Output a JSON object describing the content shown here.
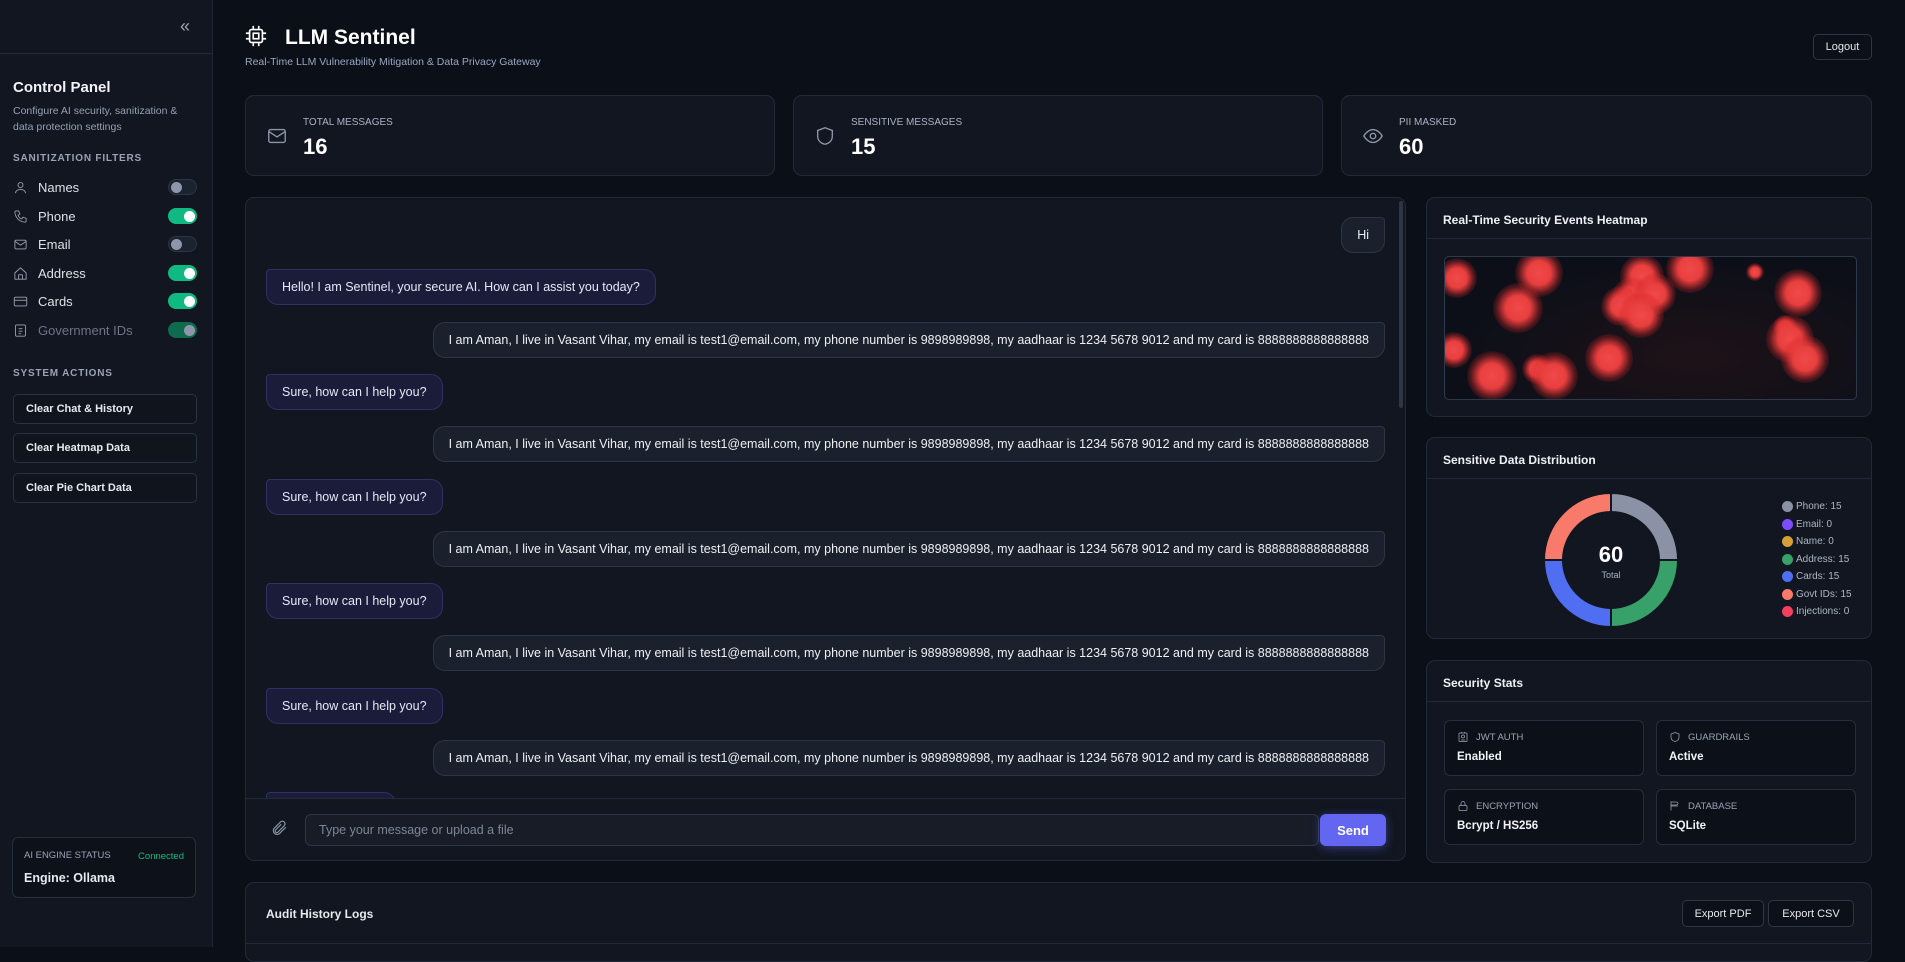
{
  "sidebar": {
    "collapse_icon": "chevrons-left-icon",
    "title": "Control Panel",
    "description": "Configure AI security, sanitization & data protection settings",
    "filters_heading": "SANITIZATION FILTERS",
    "filters": [
      {
        "label": "Names",
        "icon": "user-icon",
        "enabled": false,
        "disabled": false
      },
      {
        "label": "Phone",
        "icon": "phone-icon",
        "enabled": true,
        "disabled": false
      },
      {
        "label": "Email",
        "icon": "mail-icon",
        "enabled": false,
        "disabled": false
      },
      {
        "label": "Address",
        "icon": "home-icon",
        "enabled": true,
        "disabled": false
      },
      {
        "label": "Cards",
        "icon": "credit-card-icon",
        "enabled": true,
        "disabled": false
      },
      {
        "label": "Government IDs",
        "icon": "id-card-icon",
        "enabled": true,
        "disabled": true
      }
    ],
    "actions_heading": "SYSTEM ACTIONS",
    "actions": [
      "Clear Chat & History",
      "Clear Heatmap Data",
      "Clear Pie Chart Data"
    ],
    "engine": {
      "label": "AI ENGINE STATUS",
      "status": "Connected",
      "status_color": "#10b981",
      "value": "Engine: Ollama"
    }
  },
  "header": {
    "title": "LLM Sentinel",
    "subtitle": "Real-Time LLM Vulnerability Mitigation & Data Privacy Gateway",
    "logout": "Logout"
  },
  "stats": [
    {
      "label": "TOTAL MESSAGES",
      "value": "16",
      "icon": "mail-icon"
    },
    {
      "label": "SENSITIVE MESSAGES",
      "value": "15",
      "icon": "shield-icon"
    },
    {
      "label": "PII MASKED",
      "value": "60",
      "icon": "eye-icon"
    }
  ],
  "chat": {
    "messages": [
      {
        "role": "user",
        "text": "Hi"
      },
      {
        "role": "bot",
        "text": "Hello! I am Sentinel, your secure AI. How can I assist you today?"
      },
      {
        "role": "user",
        "text": "I am Aman, I live in Vasant Vihar, my email is test1@email.com, my phone number is 9898989898, my aadhaar is 1234 5678 9012 and my card is 8888888888888888"
      },
      {
        "role": "bot",
        "text": "Sure, how can I help you?"
      },
      {
        "role": "user",
        "text": "I am Aman, I live in Vasant Vihar, my email is test1@email.com, my phone number is 9898989898, my aadhaar is 1234 5678 9012 and my card is 8888888888888888"
      },
      {
        "role": "bot",
        "text": "Sure, how can I help you?"
      },
      {
        "role": "user",
        "text": "I am Aman, I live in Vasant Vihar, my email is test1@email.com, my phone number is 9898989898, my aadhaar is 1234 5678 9012 and my card is 8888888888888888"
      },
      {
        "role": "bot",
        "text": "Sure, how can I help you?"
      },
      {
        "role": "user",
        "text": "I am Aman, I live in Vasant Vihar, my email is test1@email.com, my phone number is 9898989898, my aadhaar is 1234 5678 9012 and my card is 8888888888888888"
      },
      {
        "role": "bot",
        "text": "Sure, how can I help you?"
      },
      {
        "role": "user",
        "text": "I am Aman, I live in Vasant Vihar, my email is test1@email.com, my phone number is 9898989898, my aadhaar is 1234 5678 9012 and my card is 8888888888888888"
      },
      {
        "role": "bot",
        "text": ""
      }
    ],
    "placeholder": "Type your message or upload a file",
    "input_value": "",
    "send": "Send",
    "accent": "#6366f1"
  },
  "heatmap": {
    "title": "Real-Time Security Events Heatmap"
  },
  "distribution": {
    "title": "Sensitive Data Distribution"
  },
  "chart_data": {
    "type": "pie",
    "title": "Sensitive Data Distribution",
    "center_value": "60",
    "center_label": "Total",
    "legend_position": "right",
    "categories": [
      "Phone",
      "Email",
      "Name",
      "Address",
      "Cards",
      "Govt IDs",
      "Injections"
    ],
    "values": [
      15,
      0,
      0,
      15,
      15,
      15,
      0
    ],
    "colors": [
      "#8b92a5",
      "#7c4dff",
      "#d4a03a",
      "#38a169",
      "#4f6ef2",
      "#f87a6b",
      "#f43f5e"
    ]
  },
  "security": {
    "title": "Security Stats",
    "items": [
      {
        "label": "JWT AUTH",
        "value": "Enabled",
        "icon": "badge-icon"
      },
      {
        "label": "GUARDRAILS",
        "value": "Active",
        "icon": "shield-icon"
      },
      {
        "label": "ENCRYPTION",
        "value": "Bcrypt / HS256",
        "icon": "lock-icon"
      },
      {
        "label": "DATABASE",
        "value": "SQLite",
        "icon": "database-icon"
      }
    ]
  },
  "audit": {
    "title": "Audit History Logs",
    "export_pdf": "Export PDF",
    "export_csv": "Export CSV"
  }
}
